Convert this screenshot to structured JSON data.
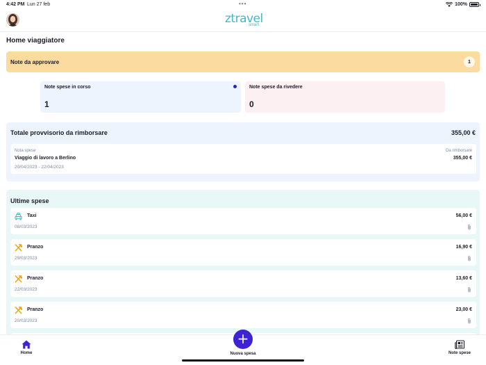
{
  "status_bar": {
    "time": "4:42 PM",
    "date": "Lun 27 feb",
    "battery": "100%"
  },
  "header": {
    "logo_main": "ztravel",
    "logo_sub": "smart"
  },
  "page_title": "Home viaggiatore",
  "approve": {
    "label": "Note da approvare",
    "count": "1"
  },
  "cards": {
    "in_progress": {
      "label": "Note spese in corso",
      "value": "1"
    },
    "to_review": {
      "label": "Note spese da rivedere",
      "value": "0"
    }
  },
  "total": {
    "title": "Totale provvisorio da rimborsare",
    "amount": "355,00 €",
    "note": {
      "key": "Nota spese",
      "name": "Viaggio di lavoro a Berlino",
      "dates": "20/04/2023 - 22/04/2023",
      "refund_key": "Da rimborsare",
      "refund_value": "355,00 €"
    }
  },
  "latest": {
    "title": "Ultime spese",
    "items": [
      {
        "name": "Taxi",
        "date": "08/03/2023",
        "amount": "56,00 €",
        "icon": "taxi-icon"
      },
      {
        "name": "Pranzo",
        "date": "29/03/2023",
        "amount": "16,90 €",
        "icon": "fork-knife-icon"
      },
      {
        "name": "Pranzo",
        "date": "22/03/2023",
        "amount": "13,60 €",
        "icon": "fork-knife-icon"
      },
      {
        "name": "Pranzo",
        "date": "20/03/2023",
        "amount": "23,00 €",
        "icon": "fork-knife-icon"
      }
    ]
  },
  "tabbar": {
    "home": "Home",
    "new": "Nuova spesa",
    "notes": "Note spese"
  },
  "colors": {
    "accent": "#3d22d6",
    "brand": "#3fb8c9",
    "approve_bg": "#fcdba1",
    "taxi": "#3fb8c9",
    "food": "#f2a20c"
  }
}
